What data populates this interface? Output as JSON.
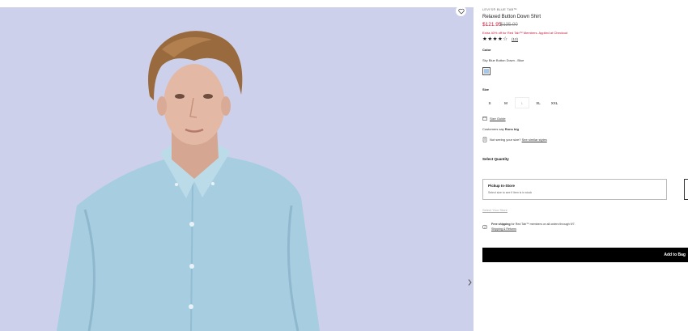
{
  "product": {
    "brand": "LEVI'S® BLUE TAB™",
    "name": "Relaxed Button Down Shirt",
    "price": "$121.95",
    "original_price": "$135.00",
    "promo": "Extra 40% off for Red Tab™ Members. Applied at Checkout",
    "stars": "★★★★☆",
    "rating": 4.5,
    "review_count": "(12)"
  },
  "color": {
    "label": "Color",
    "selected": "Sky Blue Button Down - Blue",
    "swatch_hex": "#a8c6e6"
  },
  "size": {
    "label": "Size",
    "options": [
      {
        "label": "S",
        "available": true
      },
      {
        "label": "M",
        "available": true
      },
      {
        "label": "L",
        "available": false
      },
      {
        "label": "XL",
        "available": true
      },
      {
        "label": "XXL",
        "available": true
      }
    ],
    "size_guide": "Size Guide",
    "fit_note_prefix": "Customers say ",
    "fit_note_value": "Runs big",
    "not_seeing_text": "Not seeing your size?",
    "similar_link": "See similar styles"
  },
  "quantity": {
    "label": "Select Quantity"
  },
  "pickup": {
    "title": "Pickup In-Store",
    "subtitle": "Select size to see if item is in stock",
    "select_store": "Select Your Store"
  },
  "shipping": {
    "bold": "Free shipping",
    "text": " for Red Tab™ members on all orders through 9/7.",
    "link": "Shipping & Returns"
  },
  "actions": {
    "add_to_bag": "Add to Bag"
  },
  "icons": {
    "wishlist": "heart-icon",
    "next": "chevron-right-icon",
    "size_guide": "ruler-icon",
    "similar": "hanger-icon",
    "shipping": "truck-icon"
  },
  "colors": {
    "accent": "#c41230",
    "hero_bg": "#cdd0ea",
    "button": "#000000"
  }
}
